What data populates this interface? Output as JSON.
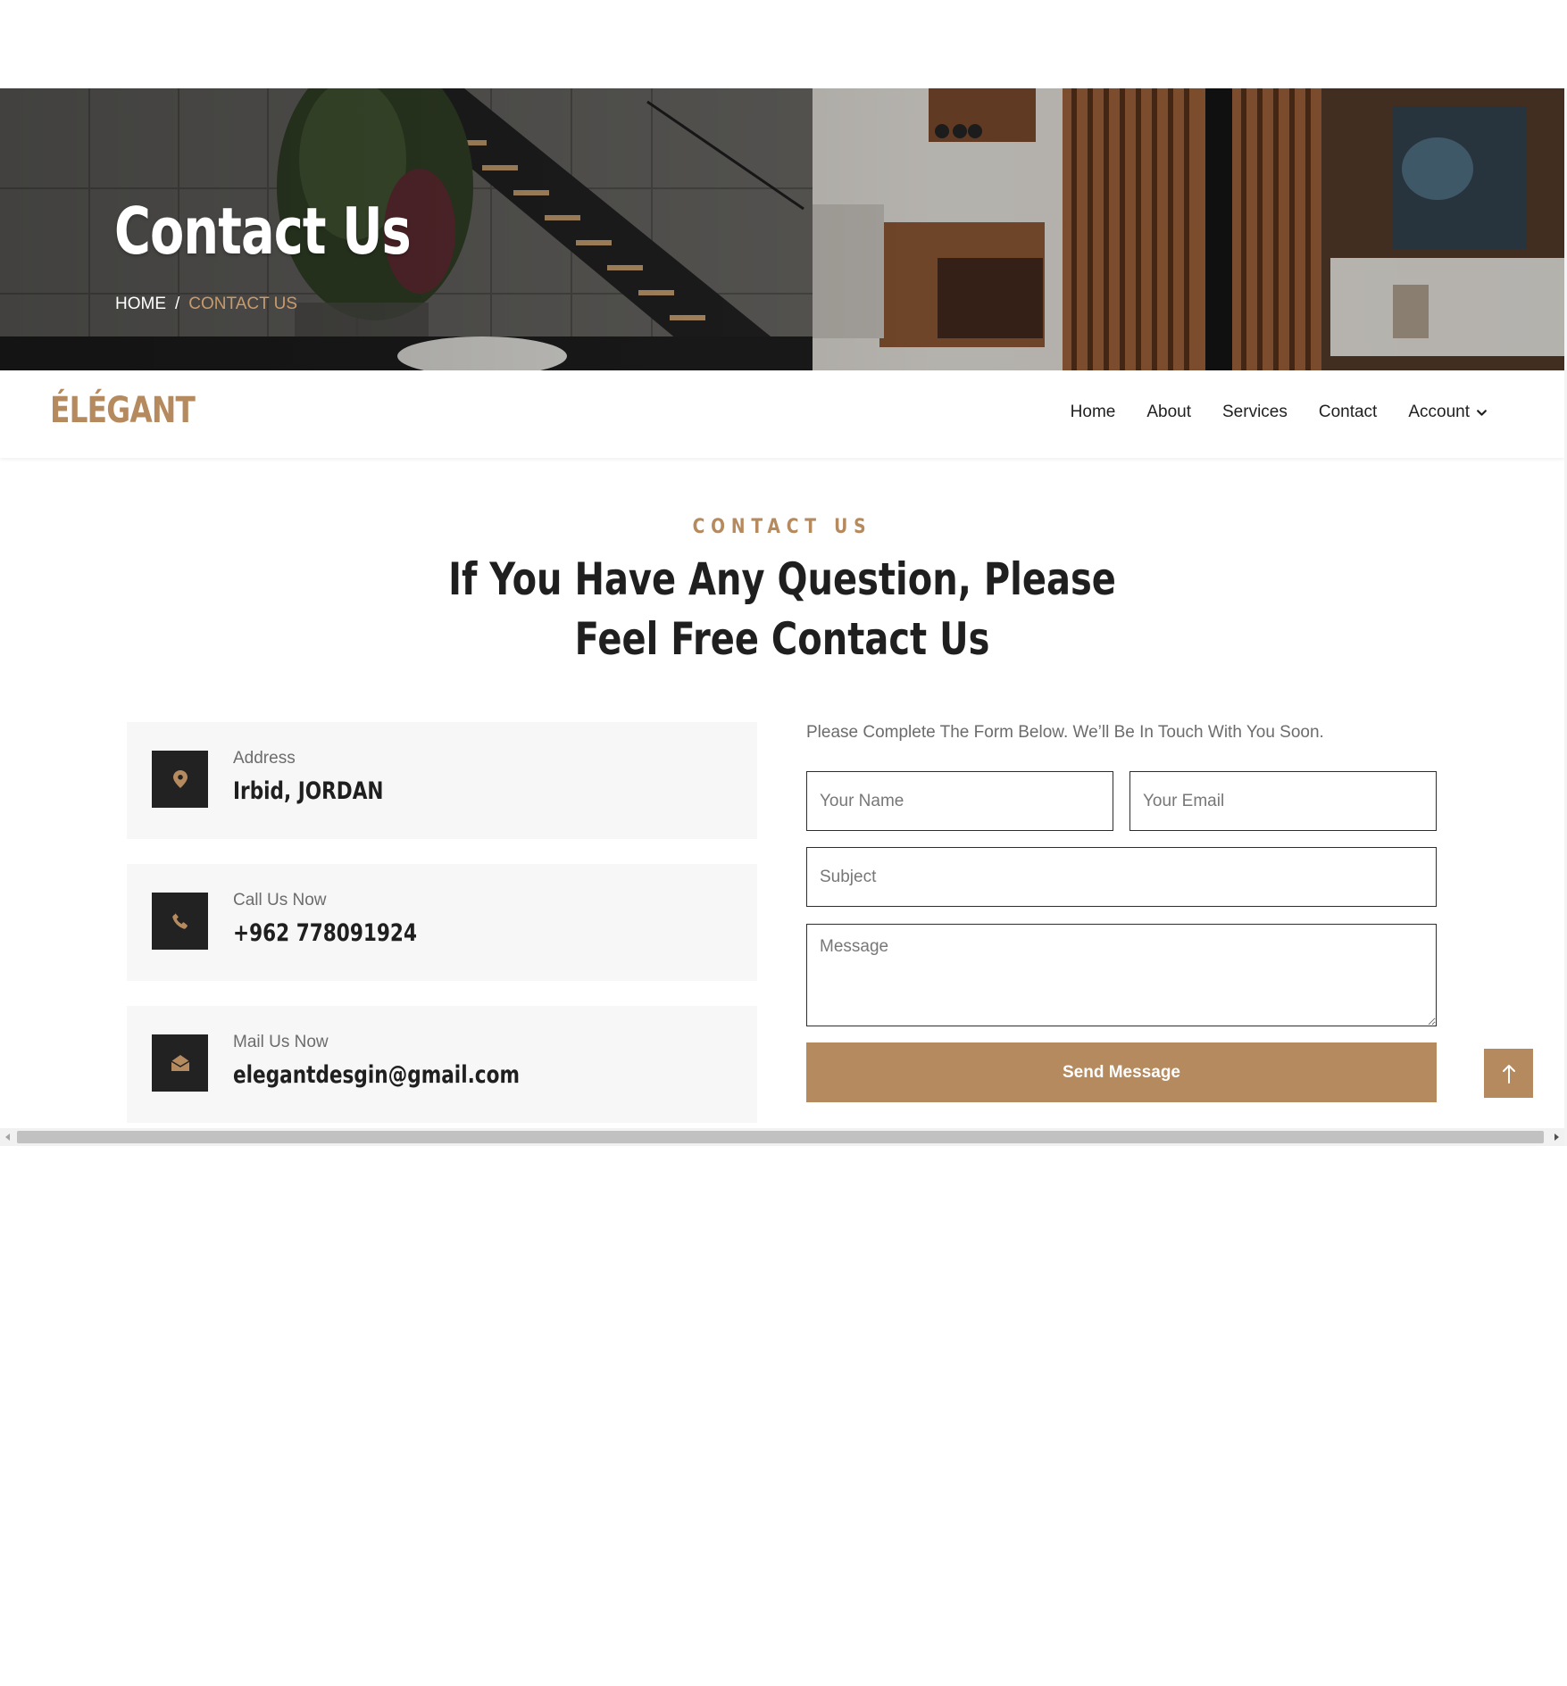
{
  "hero": {
    "title": "Contact Us",
    "breadcrumb": {
      "home": "HOME",
      "separator": "/",
      "current": "CONTACT US"
    }
  },
  "nav": {
    "logo": "ÉLÉGANT",
    "links": [
      "Home",
      "About",
      "Services",
      "Contact",
      "Account"
    ]
  },
  "section": {
    "eyebrow": "CONTACT US",
    "headline_line1": "If You Have Any Question, Please",
    "headline_line2": "Feel Free Contact Us"
  },
  "info": [
    {
      "label": "Address",
      "value": "Irbid, JORDAN",
      "icon": "map-pin-icon"
    },
    {
      "label": "Call Us Now",
      "value": "+962 778091924",
      "icon": "phone-icon"
    },
    {
      "label": "Mail Us Now",
      "value": "elegantdesgin@gmail.com",
      "icon": "envelope-open-icon"
    }
  ],
  "form": {
    "intro": "Please Complete The Form Below. We’ll Be In Touch With You Soon.",
    "name_placeholder": "Your Name",
    "email_placeholder": "Your Email",
    "subject_placeholder": "Subject",
    "message_placeholder": "Message",
    "submit_label": "Send Message"
  },
  "colors": {
    "accent": "#b68a5f",
    "dark": "#222222",
    "text": "#1f1f1f",
    "muted": "#6c6c6c",
    "card_bg": "#f7f7f7"
  },
  "icons": {
    "back_to_top": "arrow-up-icon",
    "account_dropdown": "chevron-down-icon"
  }
}
